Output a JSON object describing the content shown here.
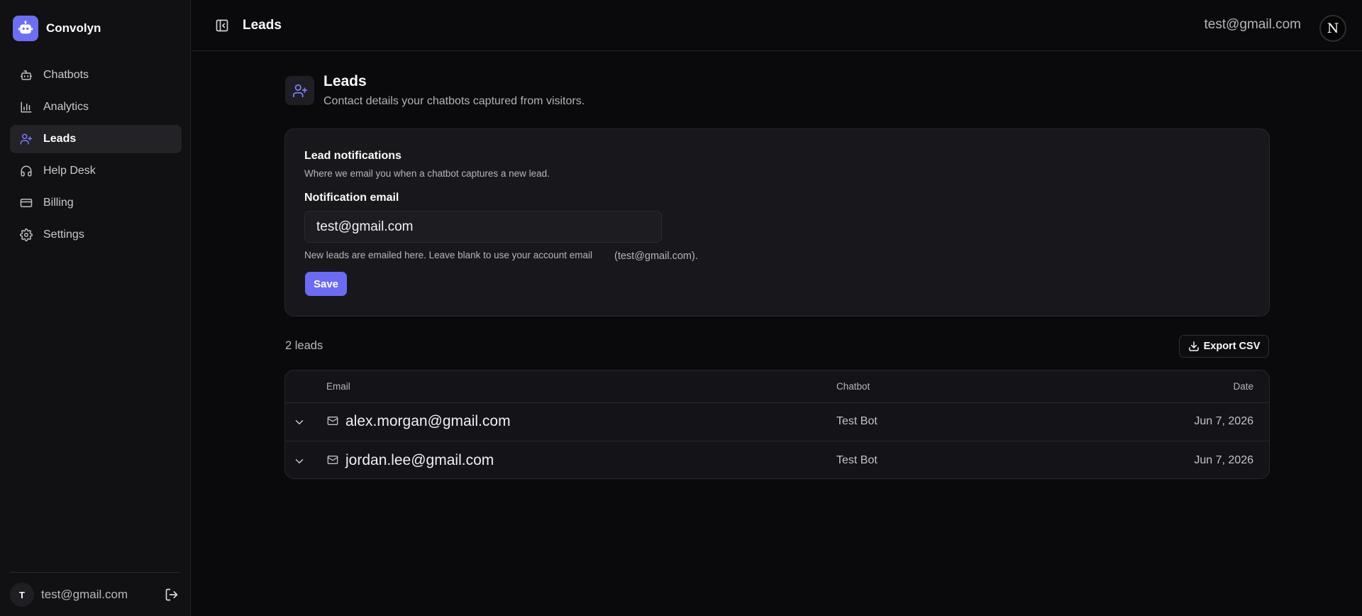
{
  "brand": {
    "name": "Convolyn"
  },
  "sidebar": {
    "items": [
      {
        "label": "Chatbots",
        "icon": "bot-icon"
      },
      {
        "label": "Analytics",
        "icon": "bar-chart-icon"
      },
      {
        "label": "Leads",
        "icon": "user-plus-icon",
        "active": true
      },
      {
        "label": "Help Desk",
        "icon": "headset-icon"
      },
      {
        "label": "Billing",
        "icon": "credit-card-icon"
      },
      {
        "label": "Settings",
        "icon": "gear-icon"
      }
    ],
    "user": {
      "initial": "T",
      "email": "test@gmail.com"
    }
  },
  "header": {
    "title": "Leads",
    "email": "test@gmail.com",
    "avatar_initial": "N"
  },
  "page": {
    "title": "Leads",
    "subtitle": "Contact details your chatbots captured from visitors."
  },
  "notifications": {
    "title": "Lead notifications",
    "description": "Where we email you when a chatbot captures a new lead.",
    "field_label": "Notification email",
    "field_value": "test@gmail.com",
    "help_text": "New leads are emailed here. Leave blank to use your account email",
    "help_email": "(test@gmail.com).",
    "save_label": "Save"
  },
  "leads": {
    "count_label": "2 leads",
    "export_label": "Export CSV",
    "columns": {
      "email": "Email",
      "chatbot": "Chatbot",
      "date": "Date"
    },
    "rows": [
      {
        "email": "alex.morgan@gmail.com",
        "chatbot": "Test Bot",
        "date": "Jun 7, 2026"
      },
      {
        "email": "jordan.lee@gmail.com",
        "chatbot": "Test Bot",
        "date": "Jun 7, 2026"
      }
    ]
  },
  "colors": {
    "accent": "#6b6cf2",
    "background": "#0a0a0d",
    "sidebar": "#111114",
    "card": "#18181c"
  }
}
